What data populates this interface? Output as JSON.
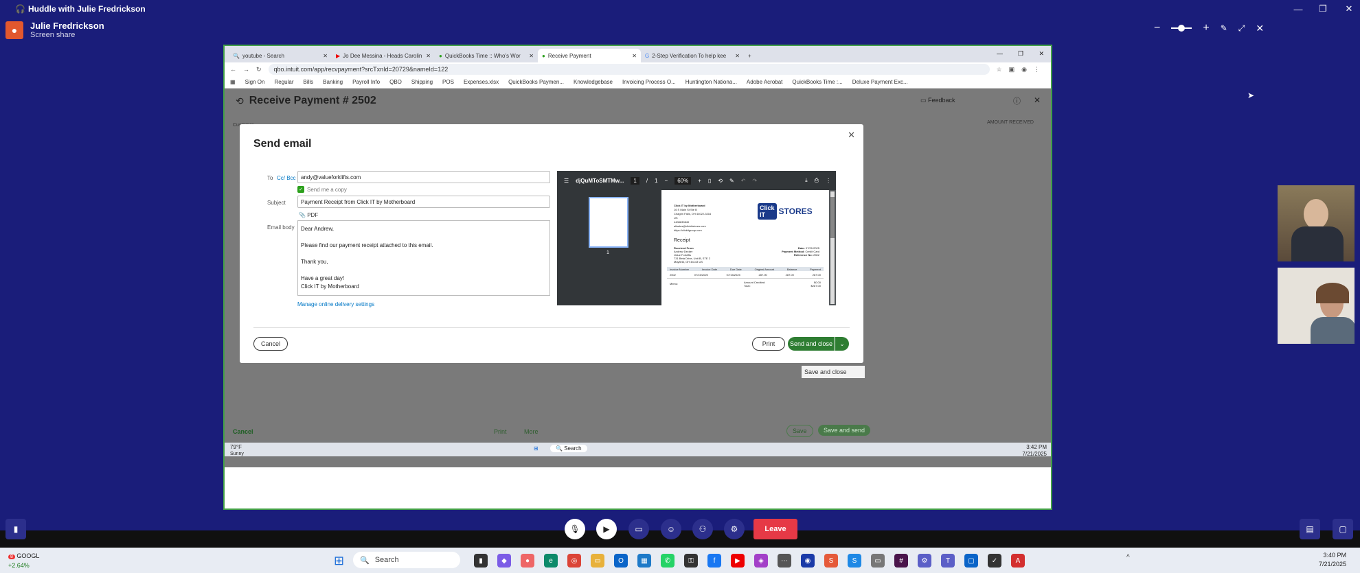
{
  "huddle": {
    "title": "Huddle with Julie Fredrickson",
    "presenter_name": "Julie Fredrickson",
    "presenter_sub": "Screen share"
  },
  "browser": {
    "tabs": [
      {
        "label": "youtube - Search"
      },
      {
        "label": "Jo Dee Messina - Heads Carolin"
      },
      {
        "label": "QuickBooks Time :: Who's Wor"
      },
      {
        "label": "Receive Payment"
      },
      {
        "label": "2-Step Verification To help kee"
      }
    ],
    "url": "qbo.intuit.com/app/recvpayment?srcTxnId=20729&nameId=122",
    "bookmarks": [
      "Sign On",
      "Regular",
      "Bills",
      "Banking",
      "Payroll Info",
      "QBO",
      "Shipping",
      "POS",
      "Expenses.xlsx",
      "QuickBooks Paymen...",
      "Knowledgebase",
      "Invoicing Process O...",
      "Huntington Nationa...",
      "Adobe Acrobat",
      "QuickBooks Time :...",
      "Deluxe Payment Exc..."
    ]
  },
  "qbo": {
    "title": "Receive Payment # 2502",
    "feedback": "Feedback",
    "amount_received": "AMOUNT RECEIVED",
    "customer_label": "Customer",
    "cancel": "Cancel",
    "print": "Print",
    "more": "More",
    "save": "Save",
    "save_and_send": "Save and send",
    "save_and_close": "Save and close"
  },
  "email": {
    "title": "Send email",
    "to_label": "To",
    "cc_bcc": "Cc/ Bcc",
    "to_value": "andy@valueforklifts.com",
    "send_copy": "Send me a copy",
    "subject_label": "Subject",
    "subject_value": "Payment Receipt from Click IT by Motherboard",
    "attachment": "PDF",
    "body_label": "Email body",
    "body_lines": [
      "Dear Andrew,",
      "Please find our payment receipt attached to this email.",
      "Thank you,",
      "Have a great day!",
      "Click IT by Motherboard"
    ],
    "manage_link": "Manage online delivery settings",
    "cancel": "Cancel",
    "print": "Print",
    "send_close": "Send and close"
  },
  "pdf": {
    "filename": "djQuMToSMTMw...",
    "page": "1",
    "pages": "1",
    "zoom": "60%",
    "thumb_num": "1",
    "company": "Click IT by Motherboard",
    "addr_lines": [
      "16 S Main St Ste B",
      "Chagrin Falls, OH 44022-3216",
      "US",
      "4408639840",
      "allsales@clickitstores.com",
      "https://clickitgroup.com"
    ],
    "logo": "Click IT STORES",
    "receipt": "Receipt",
    "received_from": "Received From",
    "customer_lines": [
      "Andrew Decker",
      "Value Forklifts",
      "731 Beta Drive, Unit B, STE 2",
      "Mayfield, OH 44143 US"
    ],
    "date_label": "Date:",
    "date": "07/21/2025",
    "method_label": "Payment Method:",
    "method": "Credit Card",
    "ref_label": "Reference No:",
    "ref": "2502",
    "cols": [
      "Invoice Number",
      "Invoice Date",
      "Due Date",
      "Original Amount",
      "Balance",
      "Payment"
    ],
    "row": [
      "2502",
      "07/15/2025",
      "07/15/2025",
      "287.00",
      "287.00",
      "287.00"
    ],
    "memo": "Memo:",
    "credited_label": "Amount Credited:",
    "credited": "$0.00",
    "total_label": "Total:",
    "total": "$287.00"
  },
  "win_inner": {
    "weather": "79°F",
    "weather_sub": "Sunny",
    "search": "Search",
    "time": "3:42 PM",
    "date": "7/21/2025"
  },
  "controls": {
    "leave": "Leave"
  },
  "taskbar": {
    "stock": "GOOGL",
    "stock_change": "+2.64%",
    "stock_badge": "8",
    "search": "Search",
    "time": "3:40 PM",
    "date": "7/21/2025"
  }
}
